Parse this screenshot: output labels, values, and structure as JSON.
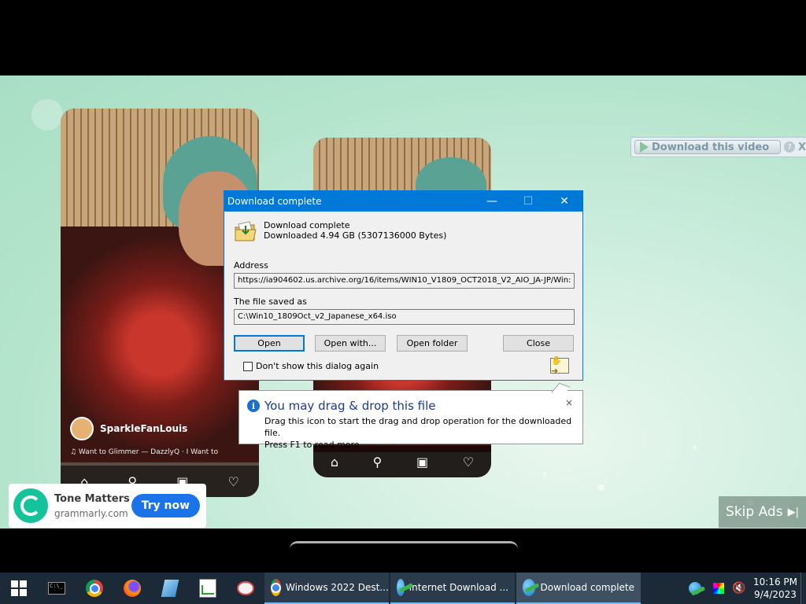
{
  "video": {
    "phone1_user": "SparkleFanLouis",
    "phone1_song": "♫ Want to Glimmer — DazzlyQ · I Want to",
    "idm_panel_label": "Download this video",
    "idm_help": "?",
    "idm_close": "X",
    "skip_label": "Skip Ads",
    "skip_icon": "▶|"
  },
  "ad": {
    "title": "Tone Matters",
    "domain": "grammarly.com",
    "cta": "Try now"
  },
  "dialog": {
    "title": "Download complete",
    "minimize": "—",
    "maximize": "☐",
    "close": "✕",
    "heading": "Download complete",
    "size_text": "Downloaded  4.94  GB (5307136000 Bytes)",
    "address_label": "Address",
    "address_value": "https://ia904602.us.archive.org/16/items/WIN10_V1809_OCT2018_V2_AIO_JA-JP/Win:",
    "saved_label": "The file saved as",
    "saved_value": "C:\\Win10_1809Oct_v2_Japanese_x64.iso",
    "open_label": "Open",
    "open_with_label": "Open with...",
    "open_folder_label": "Open folder",
    "close_label": "Close",
    "dont_show_label": "Don't show this dialog again"
  },
  "balloon": {
    "title": "You may drag & drop this file",
    "line1": "Drag this icon to start the drag and drop operation for the downloaded file.",
    "line2": "Press F1 to read more.",
    "close": "×",
    "info": "i"
  },
  "taskbar": {
    "cmd_icon": "C:\\_",
    "items": [
      {
        "label": "Windows 2022 Dest..."
      },
      {
        "label": "Internet Download ..."
      },
      {
        "label": "Download complete"
      }
    ],
    "time": "10:16 PM",
    "date": "9/4/2023"
  },
  "colors": {
    "accent": "#0078d7",
    "taskbar": "#1c2a38",
    "ad_cta": "#1a73e8",
    "grammarly": "#15c39a"
  }
}
